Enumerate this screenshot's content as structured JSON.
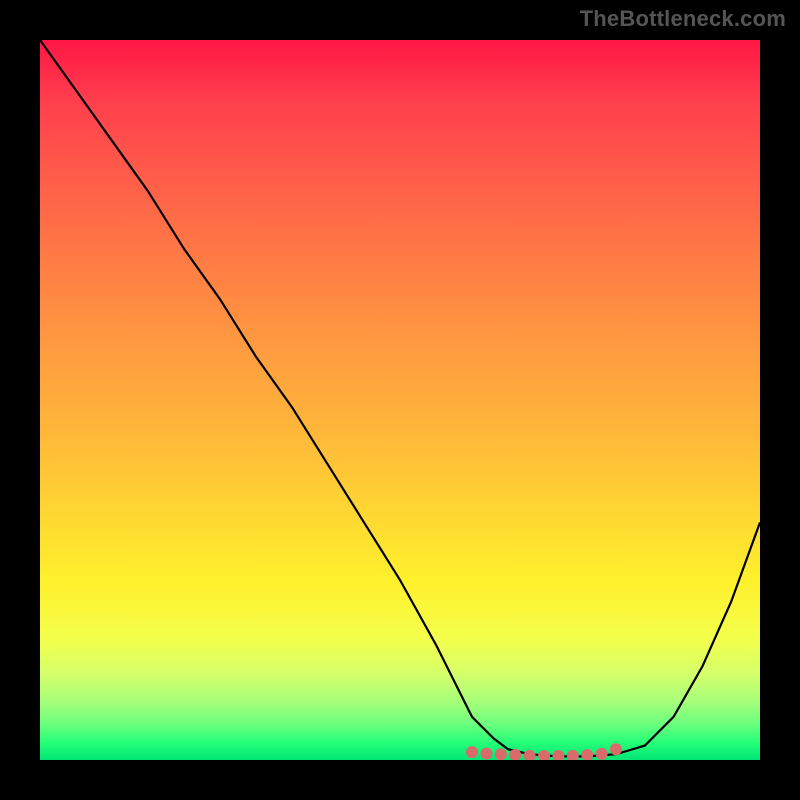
{
  "watermark": "TheBottleneck.com",
  "chart_data": {
    "type": "line",
    "title": "",
    "xlabel": "",
    "ylabel": "",
    "xlim": [
      0,
      100
    ],
    "ylim": [
      0,
      100
    ],
    "series": [
      {
        "name": "bottleneck-curve",
        "x": [
          0,
          5,
          10,
          15,
          20,
          25,
          30,
          35,
          40,
          45,
          50,
          55,
          58,
          60,
          63,
          65,
          68,
          72,
          76,
          80,
          84,
          88,
          92,
          96,
          100
        ],
        "values": [
          100,
          93,
          86,
          79,
          71,
          64,
          56,
          49,
          41,
          33,
          25,
          16,
          10,
          6,
          3,
          1.5,
          0.8,
          0.5,
          0.5,
          0.8,
          2,
          6,
          13,
          22,
          33
        ]
      }
    ],
    "markers": {
      "name": "flat-minimum-markers",
      "color": "#e57373",
      "points": [
        {
          "x": 60,
          "y": 1.1
        },
        {
          "x": 62,
          "y": 0.9
        },
        {
          "x": 64,
          "y": 0.8
        },
        {
          "x": 66,
          "y": 0.7
        },
        {
          "x": 68,
          "y": 0.6
        },
        {
          "x": 70,
          "y": 0.55
        },
        {
          "x": 72,
          "y": 0.55
        },
        {
          "x": 74,
          "y": 0.6
        },
        {
          "x": 76,
          "y": 0.7
        },
        {
          "x": 78,
          "y": 0.85
        },
        {
          "x": 80,
          "y": 1.5
        }
      ]
    }
  },
  "colors": {
    "curve": "#000000",
    "marker": "#d96b6b",
    "background_top": "#ff1744",
    "background_bottom": "#00e676"
  }
}
